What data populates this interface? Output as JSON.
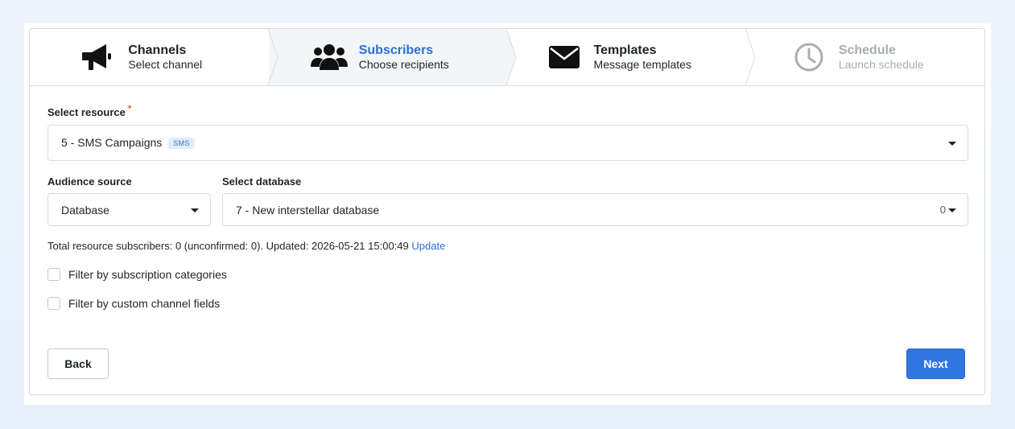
{
  "stepper": {
    "steps": [
      {
        "title": "Channels",
        "subtitle": "Select channel",
        "icon": "megaphone-icon",
        "state": "done"
      },
      {
        "title": "Subscribers",
        "subtitle": "Choose recipients",
        "icon": "users-icon",
        "state": "active"
      },
      {
        "title": "Templates",
        "subtitle": "Message templates",
        "icon": "envelope-icon",
        "state": "done"
      },
      {
        "title": "Schedule",
        "subtitle": "Launch schedule",
        "icon": "clock-icon",
        "state": "disabled"
      }
    ]
  },
  "form": {
    "resource": {
      "label": "Select resource",
      "required_mark": "*",
      "value": "5 - SMS Campaigns",
      "badge": "SMS"
    },
    "audience": {
      "label": "Audience source",
      "value": "Database"
    },
    "database": {
      "label": "Select database",
      "value": "7 - New interstellar database",
      "count": "0"
    },
    "info_text": "Total resource subscribers: 0 (unconfirmed: 0). Updated: 2026-05-21 15:00:49",
    "update_link": "Update",
    "checkboxes": [
      {
        "label": "Filter by subscription categories",
        "checked": false
      },
      {
        "label": "Filter by custom channel fields",
        "checked": false
      }
    ]
  },
  "actions": {
    "back_label": "Back",
    "next_label": "Next"
  },
  "colors": {
    "accent": "#3175e0",
    "active_text": "#2e6fd3",
    "required": "#e8623a",
    "disabled_text": "#a9adb3"
  }
}
